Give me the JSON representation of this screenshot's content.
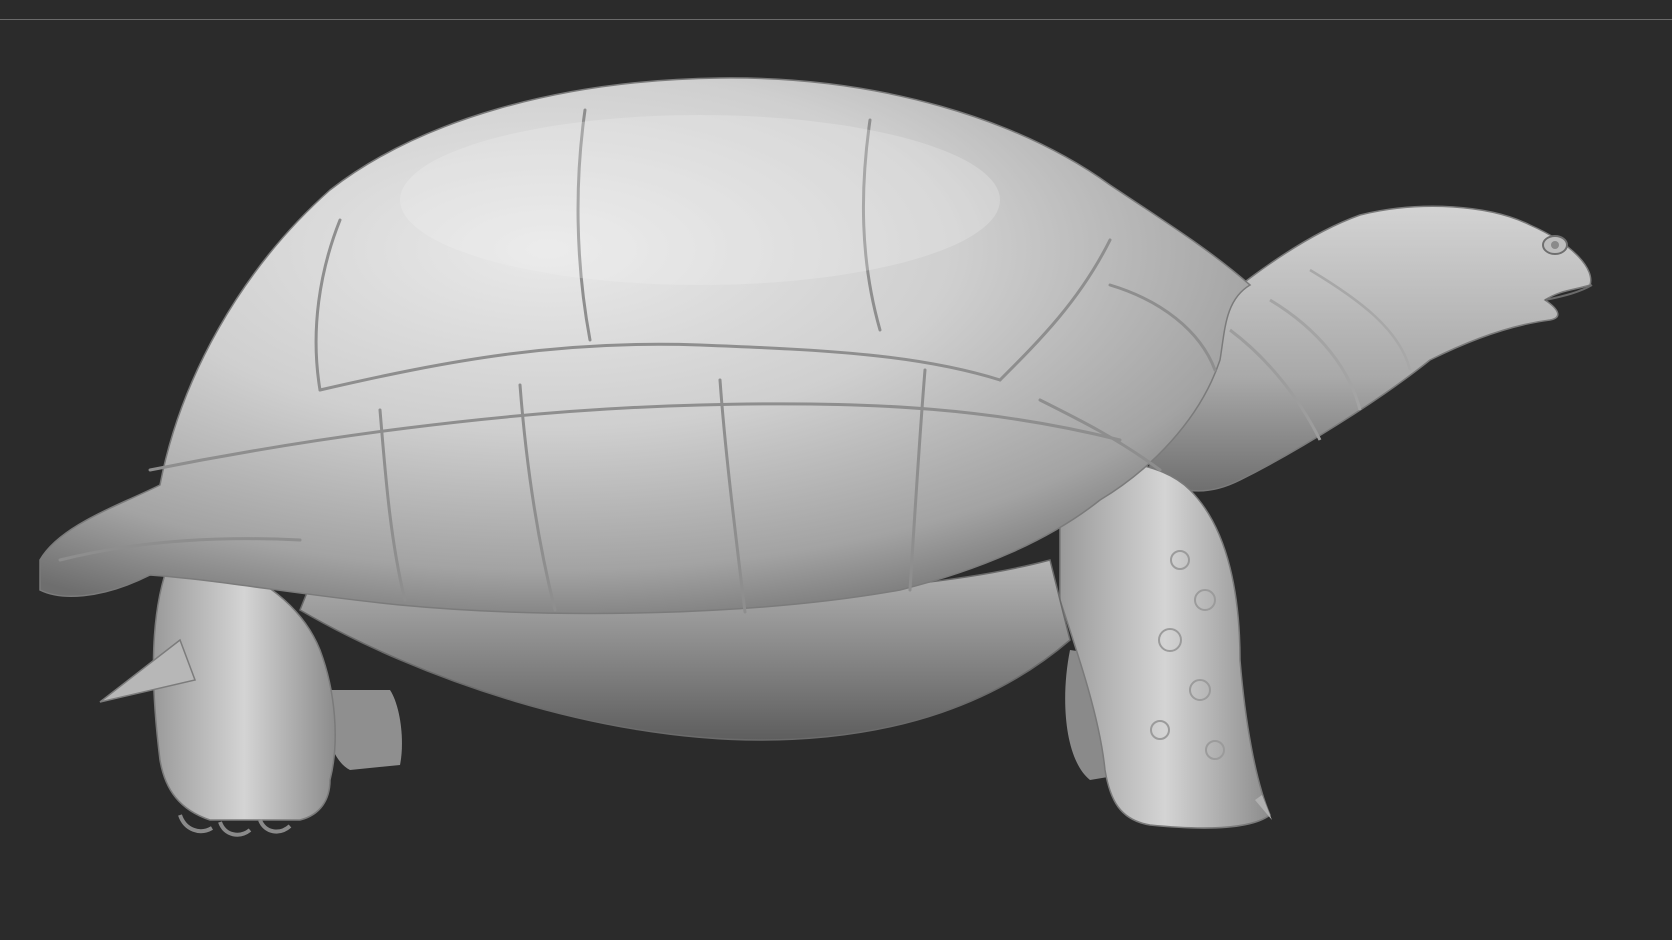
{
  "canvas": {
    "background": "#2b2b2b",
    "rule_color": "#6a6a6a"
  },
  "model": {
    "subject": "tortoise-sculpt",
    "material_color": "#c8c8c8"
  }
}
